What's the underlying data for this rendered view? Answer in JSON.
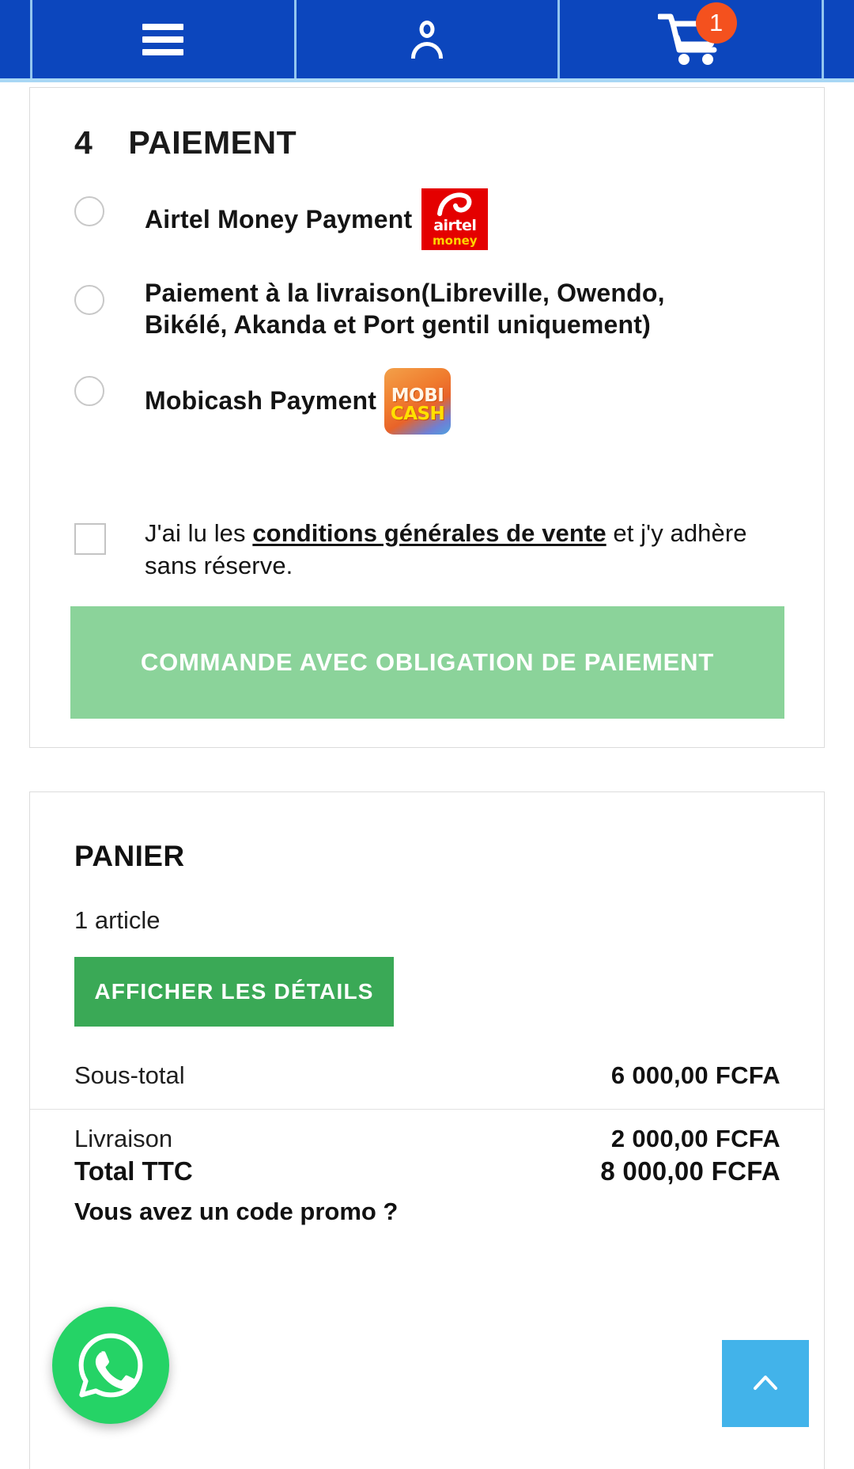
{
  "header": {
    "menu_icon": "hamburger-menu-icon",
    "account_icon": "user-account-icon",
    "cart_icon": "shopping-cart-icon",
    "cart_badge_count": "1",
    "bar_color": "#0c46bd",
    "badge_color": "#f4511e"
  },
  "payment_section": {
    "step_number": "4",
    "title": "PAIEMENT",
    "options": [
      {
        "label": "Airtel Money Payment",
        "logo": {
          "name": "airtel-money-logo",
          "line1": "airtel",
          "line2": "money",
          "bg": "#e40000"
        },
        "selected": false
      },
      {
        "label": "Paiement à la livraison(Libreville, Owendo, Bikélé, Akanda et Port gentil uniquement)",
        "logo": null,
        "selected": false
      },
      {
        "label": "Mobicash Payment",
        "logo": {
          "name": "mobicash-logo",
          "line1": "MOBI",
          "line2": "CASH",
          "bg": "#f07c2e"
        },
        "selected": false
      }
    ],
    "terms": {
      "checked": false,
      "text_before": "J'ai lu les ",
      "link_text": "conditions générales de vente",
      "text_after": " et j'y adhère sans réserve."
    },
    "submit_button": {
      "label": "COMMANDE AVEC OBLIGATION DE PAIEMENT",
      "color": "#8bd39a",
      "disabled": true
    }
  },
  "cart_summary": {
    "title": "PANIER",
    "item_count": "1 article",
    "details_button": {
      "label": "AFFICHER LES DÉTAILS",
      "color": "#3aa956"
    },
    "lines": [
      {
        "label": "Sous-total",
        "value": "6 000,00 FCFA"
      },
      {
        "label": "Livraison",
        "value": "2 000,00 FCFA"
      }
    ],
    "promo_prompt": "Vous avez un code promo ?",
    "total": {
      "label": "Total TTC",
      "value": "8 000,00 FCFA"
    }
  },
  "floating": {
    "whatsapp": {
      "name": "whatsapp-icon",
      "color": "#25d366"
    },
    "scroll_top": {
      "name": "chevron-up-icon",
      "color": "#42b3ea"
    }
  }
}
